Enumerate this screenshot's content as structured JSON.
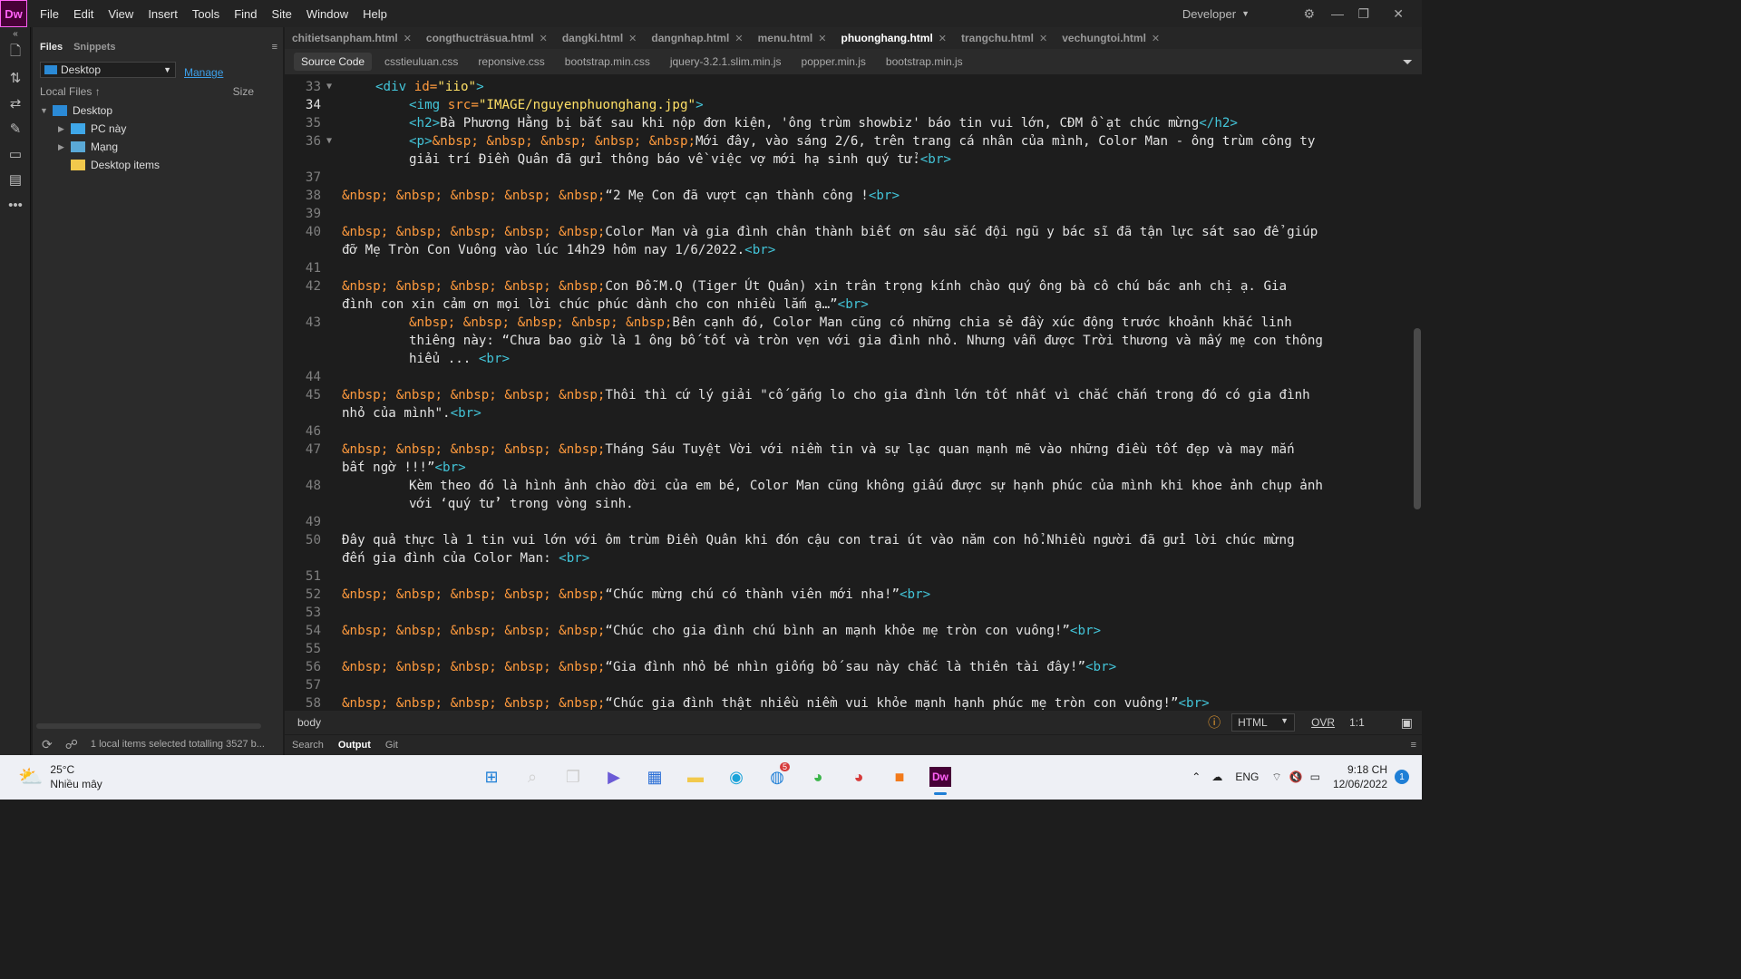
{
  "app": {
    "logo": "Dw",
    "menus": [
      "File",
      "Edit",
      "View",
      "Insert",
      "Tools",
      "Find",
      "Site",
      "Window",
      "Help"
    ],
    "workspace": "Developer"
  },
  "files_panel": {
    "tabs": [
      "Files",
      "Snippets"
    ],
    "site": "Desktop",
    "manage": "Manage",
    "local_files": "Local Files",
    "size_header": "Size",
    "tree": [
      {
        "label": "Desktop",
        "depth": 0
      },
      {
        "label": "PC này",
        "depth": 1
      },
      {
        "label": "Mạng",
        "depth": 1
      },
      {
        "label": "Desktop items",
        "depth": 1
      }
    ],
    "status": "1 local items selected totalling 3527 b..."
  },
  "document_tabs": [
    {
      "label": "chitietsanpham.html",
      "active": false
    },
    {
      "label": "congthucträsua.html",
      "active": false
    },
    {
      "label": "dangki.html",
      "active": false
    },
    {
      "label": "dangnhap.html",
      "active": false
    },
    {
      "label": "menu.html",
      "active": false
    },
    {
      "label": "phuonghang.html",
      "active": true
    },
    {
      "label": "trangchu.html",
      "active": false
    },
    {
      "label": "vechungtoi.html",
      "active": false
    }
  ],
  "related_files": [
    "Source Code",
    "csstieuluan.css",
    "reponsive.css",
    "bootstrap.min.css",
    "jquery-3.2.1.slim.min.js",
    "popper.min.js",
    "bootstrap.min.js"
  ],
  "status_bar": {
    "tag": "body",
    "language": "HTML",
    "mode": "OVR",
    "position": "1:1"
  },
  "bottom_tabs": [
    "Search",
    "Output",
    "Git"
  ],
  "taskbar": {
    "temperature": "25°C",
    "weather": "Nhiều mây",
    "language": "ENG",
    "time": "9:18 CH",
    "date": "12/06/2022",
    "notification_count": "1",
    "chrome_badge": "5"
  }
}
